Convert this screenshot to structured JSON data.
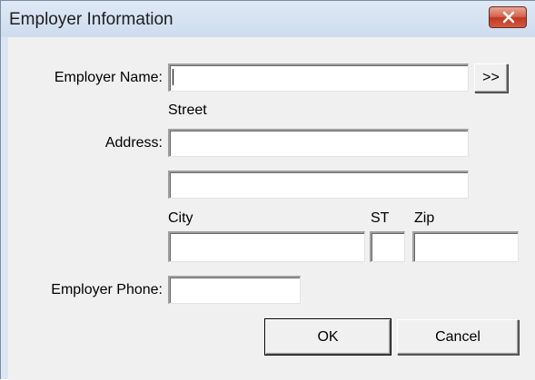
{
  "window": {
    "title": "Employer Information"
  },
  "labels": {
    "employer_name": "Employer Name:",
    "street": "Street",
    "address": "Address:",
    "city": "City",
    "st": "ST",
    "zip": "Zip",
    "employer_phone": "Employer Phone:"
  },
  "fields": {
    "employer_name": "",
    "address_line1": "",
    "address_line2": "",
    "city": "",
    "st": "",
    "zip": "",
    "employer_phone": ""
  },
  "buttons": {
    "lookup": ">>",
    "ok": "OK",
    "cancel": "Cancel"
  },
  "colors": {
    "titlebar": "#dbe6f3",
    "client": "#f0f0f0",
    "close_button": "#c9452f"
  },
  "icons": {
    "close": "close-icon"
  }
}
